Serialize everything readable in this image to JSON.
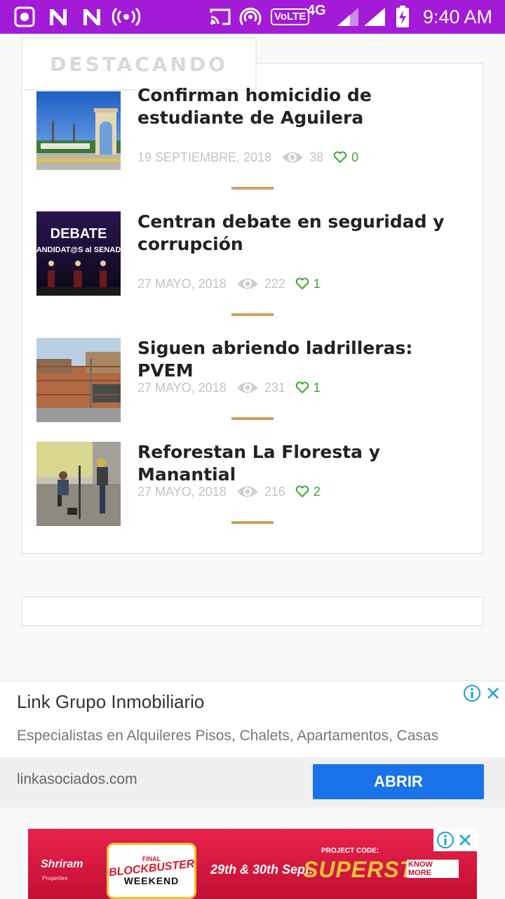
{
  "status_bar": {
    "network": "4G",
    "volte": "VoLTE",
    "time": "9:40 AM"
  },
  "section": {
    "heading": "DESTACANDO"
  },
  "news": [
    {
      "title": "Confirman homicidio de estudiante de Aguilera",
      "date": "19 SEPTIEMBRE, 2018",
      "views": "38",
      "likes": "0",
      "thumb": "arch-plaza"
    },
    {
      "title": "Centran debate en seguridad y corrupción",
      "date": "27 MAYO, 2018",
      "views": "222",
      "likes": "1",
      "thumb": "debate-stage",
      "thumb_text_1": "DEBATE",
      "thumb_text_2": "ANDIDAT@S al SENAD"
    },
    {
      "title": "Siguen abriendo ladrilleras: PVEM",
      "date": "27 MAYO, 2018",
      "views": "231",
      "likes": "1",
      "thumb": "brick-building"
    },
    {
      "title": "Reforestan La Floresta y Manantial",
      "date": "27 MAYO, 2018",
      "views": "216",
      "likes": "2",
      "thumb": "planting-trees"
    }
  ],
  "ad_text": {
    "title": "Link Grupo Inmobiliario",
    "description": "Especialistas en Alquileres Pisos, Chalets, Apartamentos, Casas",
    "domain": "linkasociados.com",
    "cta": "ABRIR"
  },
  "ad_banner": {
    "brand": "Shriram",
    "brand_sub": "Properties",
    "badge_top": "FINAL",
    "badge_main": "BLOCKBUSTER",
    "badge_bottom": "WEEKEND",
    "dates": "29th & 30th Sept.",
    "code_label": "PROJECT CODE:",
    "code_name": "SUPERSTAR",
    "cta": "KNOW MORE"
  },
  "colors": {
    "status_bar": "#a31bd6",
    "accent_bar": "#c9a463",
    "like_green": "#3aa735",
    "ad_button": "#1a73e8",
    "banner_red": "#d7192f"
  }
}
